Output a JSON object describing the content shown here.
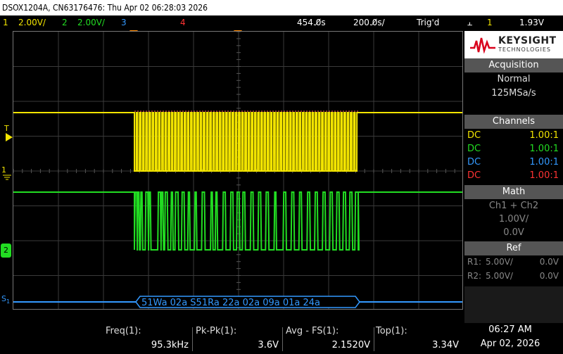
{
  "title": "DSOX1204A, CN63176476: Thu Apr 02 06:28:03 2026",
  "status": {
    "ch1": {
      "num": "1",
      "scale": "2.00V/"
    },
    "ch2": {
      "num": "2",
      "scale": "2.00V/"
    },
    "ch3": {
      "num": "3"
    },
    "ch4": {
      "num": "4"
    },
    "time_delay": "454.0̸s",
    "time_scale": "200.0̸s/",
    "trig_status": "Trig'd",
    "trig_icon": "⫠",
    "trig_source": "1",
    "trig_level": "1.93V"
  },
  "colors": {
    "ch1": "#f2e400",
    "ch2": "#22dd22",
    "ch3": "#3399ff",
    "ch4": "#ff3333",
    "serial": "#3399ff"
  },
  "markers": {
    "trig": "T",
    "ch1": "1",
    "ch2": "2",
    "serial": "S",
    "serial_sub": "1"
  },
  "decode": {
    "text": "51Wa  02a  S51Ra  22a  02a  09a  01a  24a"
  },
  "side": {
    "logo_title": "KEYSIGHT",
    "logo_sub": "TECHNOLOGIES",
    "acquisition": {
      "header": "Acquisition",
      "mode": "Normal",
      "rate": "125MSa/s"
    },
    "channels": {
      "header": "Channels",
      "rows": [
        {
          "coupling": "DC",
          "ratio": "1.00:1"
        },
        {
          "coupling": "DC",
          "ratio": "1.00:1"
        },
        {
          "coupling": "DC",
          "ratio": "1.00:1"
        },
        {
          "coupling": "DC",
          "ratio": "1.00:1"
        }
      ]
    },
    "math": {
      "header": "Math",
      "expr": "Ch1 + Ch2",
      "scale": "1.00V/",
      "offset": "0.0V"
    },
    "ref": {
      "header": "Ref",
      "rows": [
        {
          "name": "R1:",
          "scale": "5.00V/",
          "offset": "0.0V"
        },
        {
          "name": "R2:",
          "scale": "5.00V/",
          "offset": "0.0V"
        }
      ]
    }
  },
  "measurements": [
    {
      "label": "Freq(1):",
      "value": "95.3kHz"
    },
    {
      "label": "Pk-Pk(1):",
      "value": "3.6V"
    },
    {
      "label": "Avg - FS(1):",
      "value": "2.1520V"
    },
    {
      "label": "Top(1):",
      "value": "3.34V"
    }
  ],
  "clock": {
    "time": "06:27 AM",
    "date": "Apr 02, 2026"
  },
  "waveforms": {
    "ch1_pulse_count": 70,
    "ch2_pulses": [
      [
        0.0,
        0.01
      ],
      [
        0.013,
        0.02
      ],
      [
        0.026,
        0.034
      ],
      [
        0.048,
        0.06
      ],
      [
        0.063,
        0.071
      ],
      [
        0.104,
        0.116
      ],
      [
        0.119,
        0.127
      ],
      [
        0.135,
        0.147
      ],
      [
        0.162,
        0.17
      ],
      [
        0.181,
        0.195
      ],
      [
        0.21,
        0.222
      ],
      [
        0.238,
        0.246
      ],
      [
        0.268,
        0.276
      ],
      [
        0.3,
        0.313
      ],
      [
        0.34,
        0.348
      ],
      [
        0.361,
        0.369
      ],
      [
        0.394,
        0.406
      ],
      [
        0.428,
        0.44
      ],
      [
        0.456,
        0.468
      ],
      [
        0.482,
        0.493
      ],
      [
        0.518,
        0.53
      ],
      [
        0.552,
        0.564
      ],
      [
        0.586,
        0.598
      ],
      [
        0.624,
        0.632
      ],
      [
        0.664,
        0.676
      ],
      [
        0.7,
        0.712
      ],
      [
        0.735,
        0.746
      ],
      [
        0.771,
        0.783
      ],
      [
        0.805,
        0.817
      ],
      [
        0.84,
        0.852
      ],
      [
        0.872,
        0.884
      ],
      [
        0.902,
        0.914
      ],
      [
        0.931,
        0.943
      ],
      [
        0.96,
        0.972
      ],
      [
        0.985,
        1.0
      ]
    ]
  }
}
